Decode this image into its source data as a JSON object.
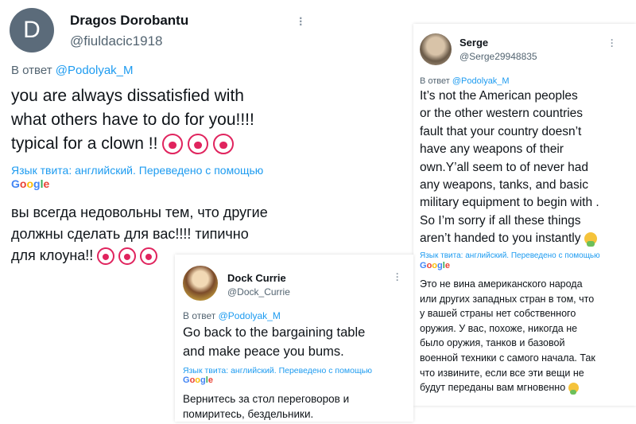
{
  "tweets": {
    "dragos": {
      "avatar_letter": "D",
      "name": "Dragos Dorobantu",
      "handle": "@fiuldacic1918",
      "reply_prefix": "В ответ",
      "reply_mention": "@Podolyak_M",
      "text_lines": [
        "you are always dissatisfied with",
        "what others have to do for you!!!!",
        "typical for a clown !!"
      ],
      "translated_label": "Язык твита: английский. Переведено с помощью",
      "translation_lines": [
        "вы всегда недовольны тем, что другие",
        "должны сделать для вас!!!! типично",
        "для клоуна!!"
      ]
    },
    "serge": {
      "name": "Serge",
      "handle": "@Serge29948835",
      "reply_prefix": "В ответ",
      "reply_mention": "@Podolyak_M",
      "text_lines": [
        "It’s not the American peoples",
        "or the other western countries",
        "fault that your country doesn’t",
        "have any weapons of their",
        "own.Y’all seem to of never had",
        "any weapons, tanks, and basic",
        "military equipment to begin with .",
        "So I’m sorry if all these things",
        "aren’t handed to you instantly"
      ],
      "translated_label": "Язык твита: английский. Переведено с помощью",
      "translation_lines": [
        "Это не вина американского народа",
        "или других западных стран в том, что",
        "у вашей страны нет собственного",
        "оружия. У вас, похоже, никогда не",
        "было оружия, танков и базовой",
        "военной техники с самого начала. Так",
        "что извините, если все эти вещи не",
        "будут переданы вам мгновенно"
      ]
    },
    "dock": {
      "name": "Dock Currie",
      "handle": "@Dock_Currie",
      "reply_prefix": "В ответ",
      "reply_mention": "@Podolyak_M",
      "text_lines": [
        "Go back to the bargaining table",
        "and make peace you bums."
      ],
      "translated_label": "Язык твита: английский. Переведено с помощью",
      "translation_lines": [
        "Вернитесь за стол переговоров и",
        "помиритесь, бездельники."
      ]
    }
  },
  "google_letters": [
    "G",
    "o",
    "o",
    "g",
    "l",
    "e"
  ],
  "icons": {
    "more": "more-vertical-icon",
    "clown": "clown-face-icon",
    "facepalm": "facepalm-icon"
  },
  "colors": {
    "link": "#1d9bf0",
    "muted": "#536471",
    "text": "#0f1419"
  }
}
